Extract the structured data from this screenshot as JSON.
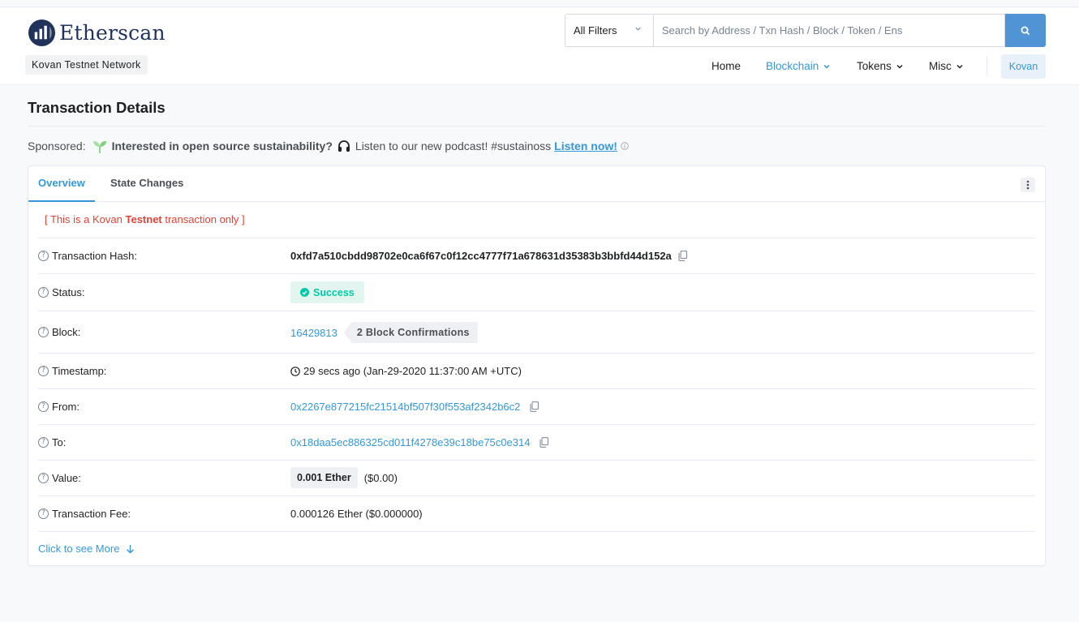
{
  "brand": {
    "name": "Etherscan",
    "network_badge": "Kovan Testnet Network"
  },
  "search": {
    "filter_label": "All Filters",
    "placeholder": "Search by Address / Txn Hash / Block / Token / Ens"
  },
  "nav": {
    "home": "Home",
    "blockchain": "Blockchain",
    "tokens": "Tokens",
    "misc": "Misc",
    "network": "Kovan"
  },
  "page": {
    "title": "Transaction Details"
  },
  "sponsor": {
    "label": "Sponsored:",
    "headline": "Interested in open source sustainability?",
    "text": "Listen to our new podcast! #sustainoss",
    "link": "Listen now!"
  },
  "tabs": {
    "overview": "Overview",
    "state_changes": "State Changes"
  },
  "notice": {
    "prefix": "[ This is a Kovan ",
    "bold": "Testnet",
    "suffix": " transaction only ]"
  },
  "details": {
    "hash_label": "Transaction Hash:",
    "hash": "0xfd7a510cbdd98702e0ca6f67c0f12cc4777f71a678631d35383b3bbfd44d152a",
    "status_label": "Status:",
    "status": "Success",
    "block_label": "Block:",
    "block": "16429813",
    "confirmations": "2 Block Confirmations",
    "timestamp_label": "Timestamp:",
    "timestamp": "29 secs ago (Jan-29-2020 11:37:00 AM +UTC)",
    "from_label": "From:",
    "from": "0x2267e877215fc21514bf507f30f553af2342b6c2",
    "to_label": "To:",
    "to": "0x18daa5ec886325cd011f4278e39c18be75c0e314",
    "value_label": "Value:",
    "value": "0.001 Ether",
    "value_usd": "($0.00)",
    "fee_label": "Transaction Fee:",
    "fee": "0.000126 Ether ($0.000000)"
  },
  "see_more": "Click to see More",
  "colors": {
    "accent": "#3498db",
    "success": "#00c9a7",
    "danger": "#de4437",
    "brand_dark": "#21325b"
  }
}
